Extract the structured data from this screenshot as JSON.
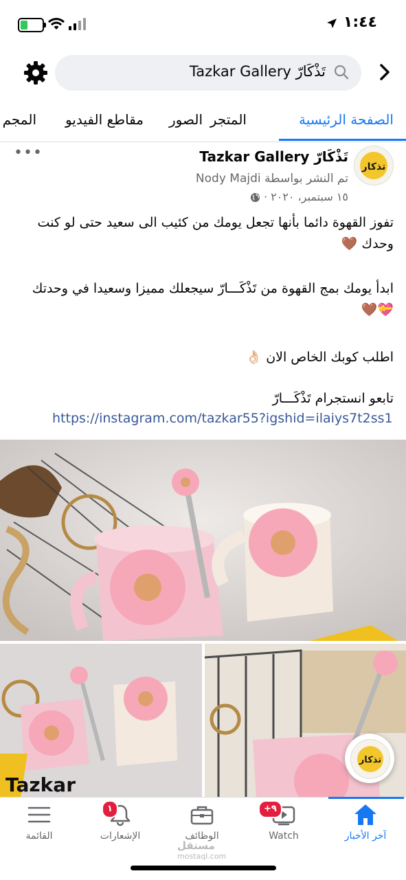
{
  "status_bar": {
    "time": "١:٤٤"
  },
  "header": {
    "search_text": "تَذْكَارّ Tazkar Gallery",
    "icons": [
      "gear-icon",
      "search-icon",
      "chevron-right-icon"
    ]
  },
  "tabs": [
    {
      "label": "الصفحة الرئيسية",
      "active": true
    },
    {
      "label": "المتجر"
    },
    {
      "label": "الصور"
    },
    {
      "label": "مقاطع الفيديو"
    },
    {
      "label": "المجم"
    }
  ],
  "post": {
    "page_name": "تَذْكَارّ Tazkar Gallery",
    "posted_by": "تم النشر بواسطة Nody Majdi",
    "date": "١٥ سبتمبر، ٢٠٢٠ ·",
    "more": "•••",
    "paragraphs": [
      "تفوز القهوة دائما بأنها تجعل يومك من كئيب الى سعيد حتى لو كنت وحدك 🤎",
      "ابدأ يومك بمج القهوة من تَذْكَـــارّ سيجعلك مميزا وسعيدا في وحدتك 💝🤎",
      "اطلب كوبك الخاص الان 👌🏻",
      "تابعو انستجرام تَذْكَـــارّ"
    ],
    "link": "https://instagram.com/tazkar55?igshid=ilaiys7t2ss1",
    "avatar_text": "تذكار",
    "photo_watermark": "Tazkar"
  },
  "bottom_nav": [
    {
      "label": "آخر الأخبار",
      "icon": "home-icon",
      "active": true
    },
    {
      "label": "Watch",
      "icon": "watch-icon",
      "badge": "+٩"
    },
    {
      "label": "الوظائف",
      "icon": "briefcase-icon"
    },
    {
      "label": "الإشعارات",
      "icon": "bell-icon",
      "badge": "١"
    },
    {
      "label": "القائمة",
      "icon": "menu-icon"
    }
  ],
  "watermark": {
    "brand": "مستقل",
    "url": "mostaql.com"
  },
  "colors": {
    "accent": "#1877f2",
    "badge": "#e41e3f",
    "link": "#385898"
  }
}
